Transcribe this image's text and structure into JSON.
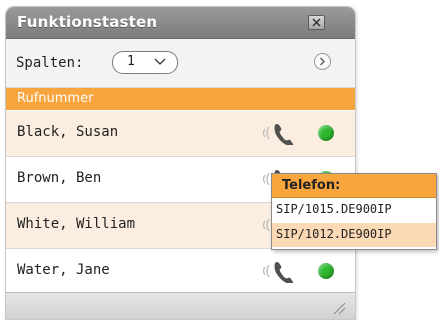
{
  "panel": {
    "title": "Funktionstasten",
    "close_icon": "close-icon"
  },
  "columns": {
    "label": "Spalten:",
    "selected": "1",
    "next_icon": "chevron-right-icon"
  },
  "list": {
    "header": "Rufnummer",
    "rows": [
      {
        "name": "Black, Susan",
        "status": "available"
      },
      {
        "name": "Brown, Ben",
        "status": "available"
      },
      {
        "name": "White, William",
        "status": "available"
      },
      {
        "name": "Water, Jane",
        "status": "available"
      }
    ]
  },
  "popup": {
    "title": "Telefon:",
    "items": [
      {
        "label": "SIP/1015.DE900IP",
        "selected": false
      },
      {
        "label": "SIP/1012.DE900IP",
        "selected": true
      }
    ]
  },
  "colors": {
    "accent": "#f7a53c",
    "row_shaded": "#fbeee0",
    "status_available": "#2eb82e",
    "titlebar": "#8a8a8a"
  }
}
